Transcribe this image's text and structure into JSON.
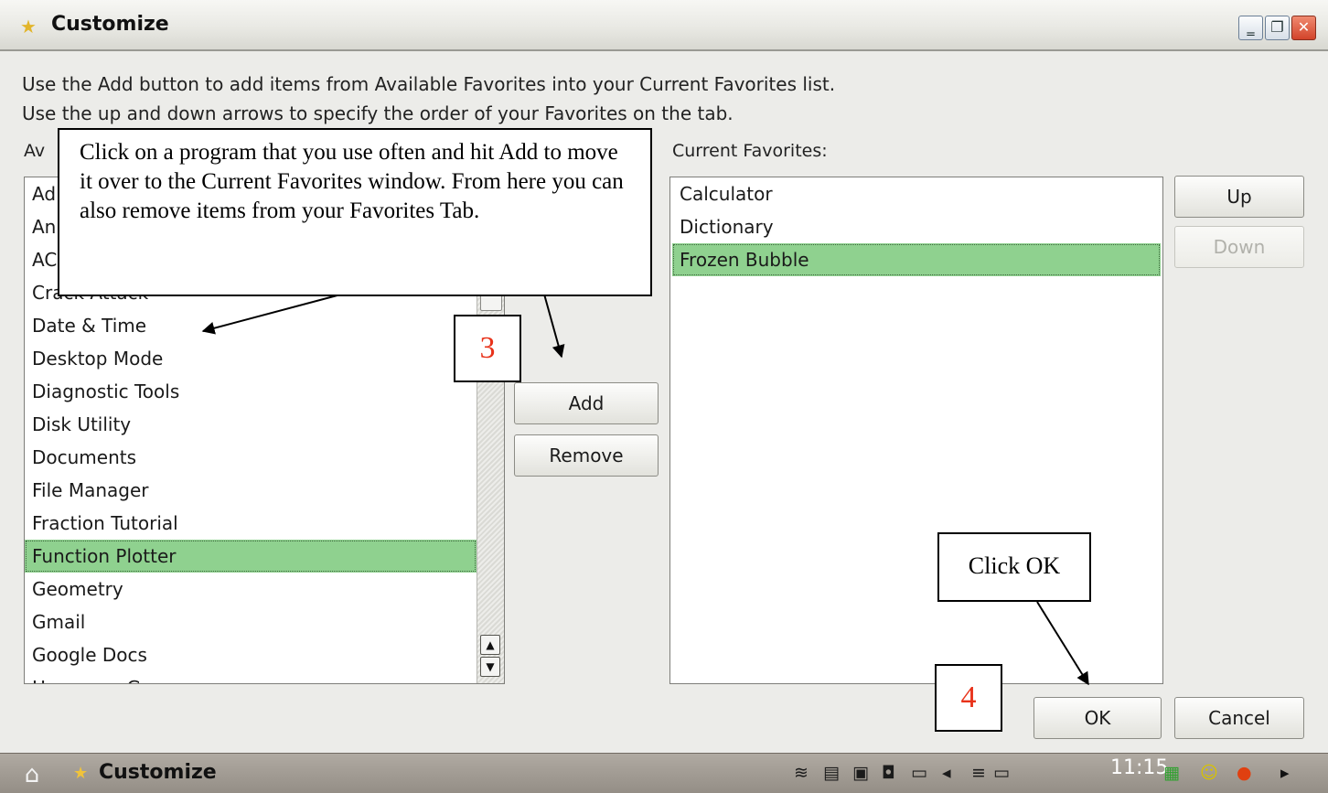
{
  "window": {
    "title": "Customize",
    "icon": "star-icon",
    "controls": [
      "minimize-icon",
      "restore-icon",
      "close-icon"
    ]
  },
  "instructions": {
    "line1": "Use the Add button to add items from Available Favorites into your Current Favorites list.",
    "line2": "Use the up and down arrows to specify the order of your Favorites on the tab."
  },
  "available": {
    "label": "Av",
    "items": [
      {
        "label": "Ad"
      },
      {
        "label": "An"
      },
      {
        "label": "AC"
      },
      {
        "label": "Crack Attack"
      },
      {
        "label": "Date & Time"
      },
      {
        "label": "Desktop Mode"
      },
      {
        "label": "Diagnostic Tools"
      },
      {
        "label": "Disk Utility"
      },
      {
        "label": "Documents"
      },
      {
        "label": "File Manager"
      },
      {
        "label": "Fraction Tutorial"
      },
      {
        "label": "Function Plotter",
        "selected": true
      },
      {
        "label": "Geometry"
      },
      {
        "label": "Gmail"
      },
      {
        "label": "Google Docs"
      },
      {
        "label": "Hangman Game"
      }
    ]
  },
  "current": {
    "label": "Current Favorites:",
    "items": [
      {
        "label": "Calculator"
      },
      {
        "label": "Dictionary"
      },
      {
        "label": "Frozen Bubble",
        "selected": true
      }
    ]
  },
  "buttons": {
    "add": "Add",
    "remove": "Remove",
    "up": "Up",
    "down": "Down",
    "ok": "OK",
    "cancel": "Cancel"
  },
  "callouts": {
    "main": "Click on a program that you use often and hit Add to move it over to the Current Favorites window.  From here you can also remove items from your Favorites Tab.",
    "click_ok": "Click OK",
    "step3": "3",
    "step4": "4"
  },
  "taskbar": {
    "home_icon": "home-icon",
    "task_label": "Customize",
    "clock": "11:15",
    "tray_icons": [
      "wifi-icon",
      "network-icon",
      "update-icon",
      "keyboard-icon",
      "battery-icon",
      "volume-icon",
      "disk-icon",
      "usb-icon",
      "grid-icon",
      "smiley-icon",
      "alert-icon",
      "expand-arrow-icon"
    ]
  },
  "colors": {
    "selection": "#8fd18f",
    "callout_number": "#e8321a",
    "close_button": "#d2442a"
  }
}
